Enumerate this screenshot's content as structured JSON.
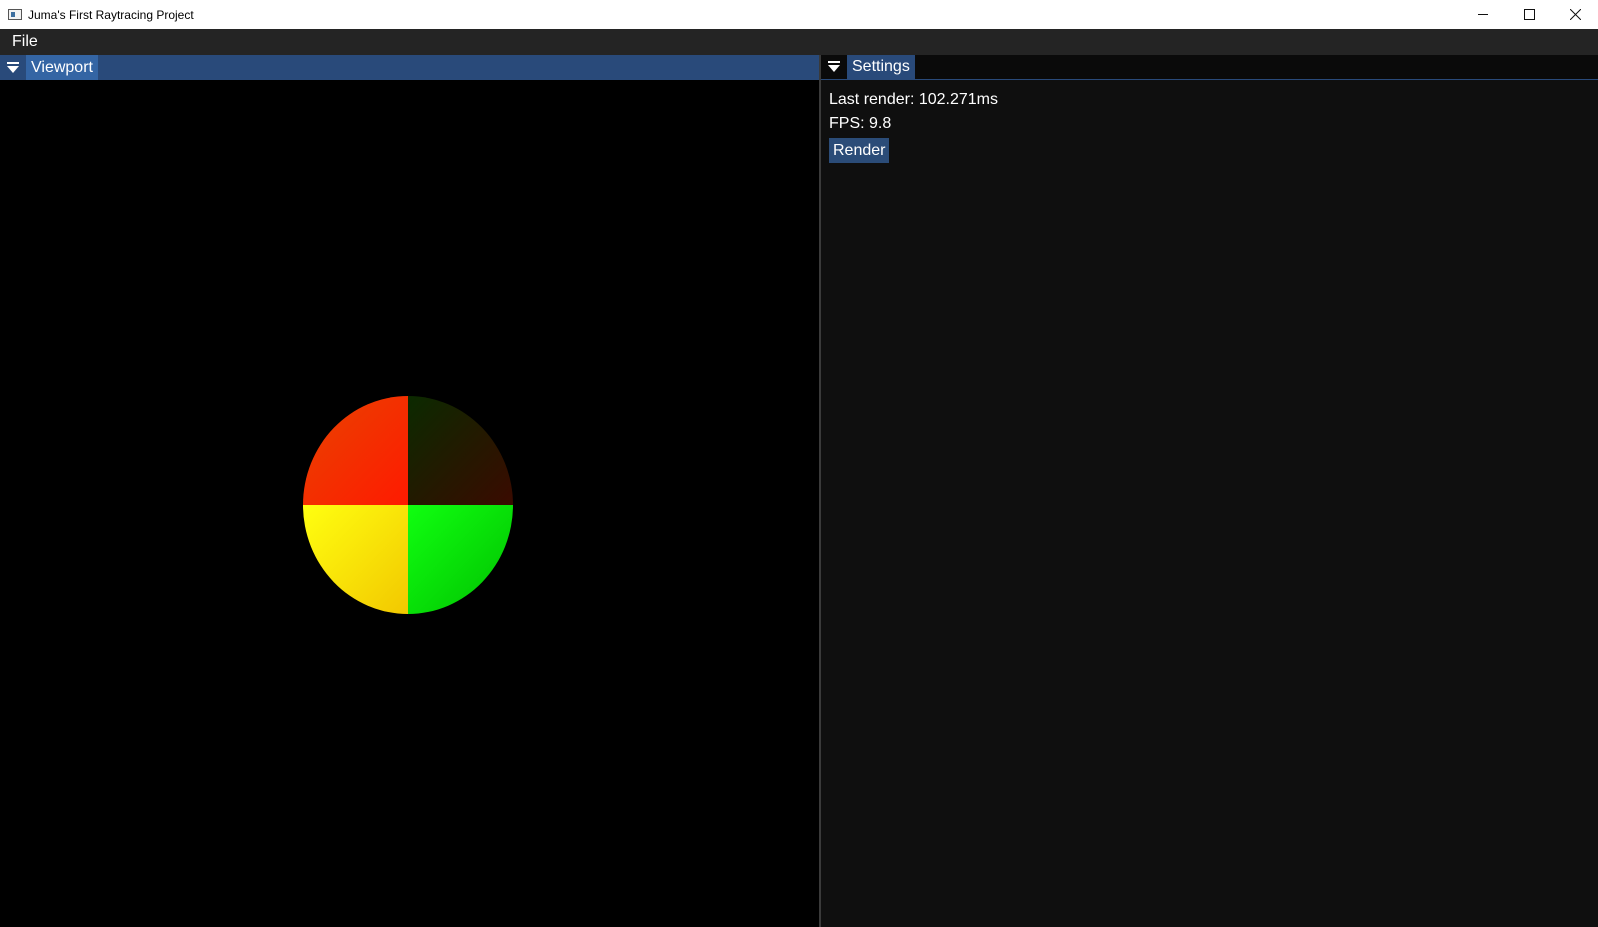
{
  "window": {
    "title": "Juma's First Raytracing Project",
    "minimize_icon": "minimize-icon",
    "maximize_icon": "maximize-icon",
    "close_icon": "close-icon"
  },
  "menu": {
    "items": [
      {
        "label": "File"
      }
    ]
  },
  "viewport": {
    "tab_label": "Viewport",
    "quadrant_colors": {
      "top_left": [
        "#ff1a00",
        "#e84400"
      ],
      "top_right": [
        "#0b2a00",
        "#3a0a00"
      ],
      "bottom_left": [
        "#ffff10",
        "#f2c800"
      ],
      "bottom_right": [
        "#10ff10",
        "#00c000"
      ]
    }
  },
  "settings": {
    "tab_label": "Settings",
    "last_render": "Last render: 102.271ms",
    "fps": "FPS: 9.8",
    "render_button": "Render"
  },
  "colors": {
    "accent": "#294a7a",
    "tab_active": "#3465a4",
    "background": "#000000",
    "panel_bg": "#0f0f0f"
  }
}
